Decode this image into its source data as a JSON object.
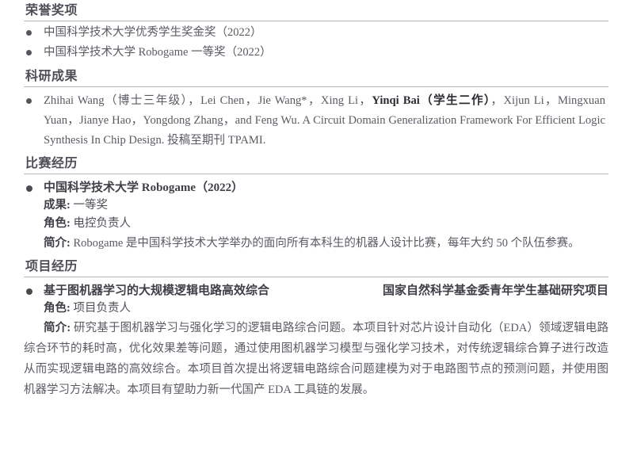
{
  "document": {
    "type": "resume-cv",
    "language": "zh-CN",
    "text_color": "#55555e",
    "rule_color": "#b9b9bf"
  },
  "sections": [
    {
      "id": "honors",
      "heading": "荣誉奖项",
      "items": [
        "中国科学技术大学优秀学生奖金奖（2022）",
        "中国科学技术大学 Robogame 一等奖（2022）"
      ]
    },
    {
      "id": "research",
      "heading": "科研成果",
      "publication": {
        "part1": "Zhihai Wang（博士三年级），Lei Chen，Jie Wang*，Xing Li，",
        "bold_name": "Yinqi Bai（学生二作）",
        "part2": "，Xijun Li，Mingxuan Yuan，Jianye Hao，Yongdong Zhang，and Feng Wu. A Circuit Domain Generalization Framework For Efficient Logic Synthesis In Chip Design. 投稿至期刊 TPAMI."
      }
    },
    {
      "id": "competition",
      "heading": "比赛经历",
      "entry": {
        "title": "中国科学技术大学 Robogame（2022）",
        "result_label": "成果:",
        "result_value": "一等奖",
        "role_label": "角色:",
        "role_value": "电控负责人",
        "desc_label": "简介:",
        "desc_text": "Robogame 是中国科学技术大学举办的面向所有本科生的机器人设计比赛，每年大约 50 个队伍参赛。"
      }
    },
    {
      "id": "projects",
      "heading": "项目经历",
      "entry": {
        "title": "基于图机器学习的大规模逻辑电路高效综合",
        "funding": "国家自然科学基金委青年学生基础研究项目",
        "role_label": "角色:",
        "role_value": "项目负责人",
        "desc_label": "简介:",
        "desc_text": "研究基于图机器学习与强化学习的逻辑电路综合问题。本项目针对芯片设计自动化（EDA）领域逻辑电路综合环节的耗时高，优化效果差等问题，通过使用图机器学习模型与强化学习技术，对传统逻辑综合算子进行改造从而实现逻辑电路的高效综合。本项目首次提出将逻辑电路综合问题建模为对于电路图节点的预测问题，并使用图机器学习方法解决。本项目有望助力新一代国产 EDA 工具链的发展。"
      }
    }
  ]
}
